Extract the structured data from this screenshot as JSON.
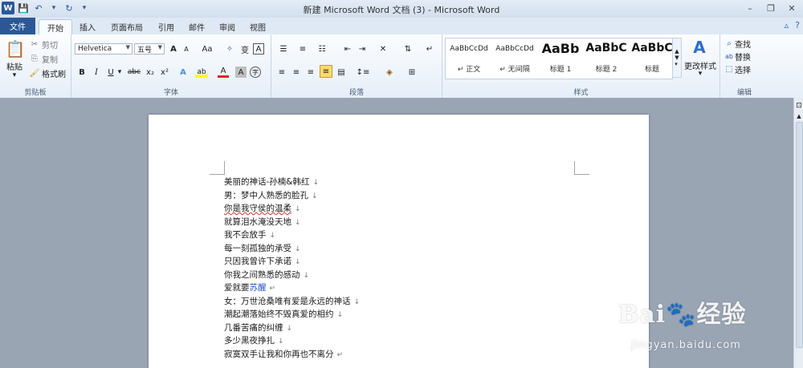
{
  "window": {
    "title": "新建 Microsoft Word 文档 (3)  -  Microsoft Word",
    "logo": "W"
  },
  "tabs": {
    "file": "文件",
    "items": [
      "开始",
      "插入",
      "页面布局",
      "引用",
      "邮件",
      "审阅",
      "视图"
    ]
  },
  "clipboard": {
    "paste": "粘贴",
    "cut": "剪切",
    "copy": "复制",
    "format_painter": "格式刷",
    "label": "剪贴板"
  },
  "font": {
    "name": "Helvetica",
    "size": "五号",
    "label": "字体",
    "buttons": {
      "grow": "A",
      "shrink": "A",
      "case": "Aa",
      "clear": "♥",
      "phonetic": "wén",
      "border": "A",
      "bold": "B",
      "italic": "I",
      "underline": "U",
      "strike": "abc",
      "sub": "x₂",
      "sup": "x²",
      "effects": "A",
      "highlight": "ab",
      "color": "A",
      "shade": "A",
      "circle": "字"
    }
  },
  "paragraph": {
    "label": "段落"
  },
  "styles": {
    "label": "样式",
    "items": [
      {
        "preview": "AaBbCcDd",
        "name": "↵ 正文"
      },
      {
        "preview": "AaBbCcDd",
        "name": "↵ 无间隔"
      },
      {
        "preview": "AaBb",
        "name": "标题 1"
      },
      {
        "preview": "AaBbC",
        "name": "标题 2"
      },
      {
        "preview": "AaBbC",
        "name": "标题"
      }
    ],
    "change": "更改样式"
  },
  "editing": {
    "label": "编辑",
    "find": "查找",
    "replace": "替换",
    "select": "选择"
  },
  "document": {
    "lines": [
      "美丽的神话-孙楠&韩红",
      "男：梦中人熟悉的脸孔",
      "你是我守侯的温柔",
      "就算泪水淹没天地",
      "我不会放手",
      "每一刻孤独的承受",
      "只因我曾许下承诺",
      "你我之间熟悉的感动",
      "爱就要",
      "女：万世沧桑唯有爱是永远的神话",
      "潮起潮落始终不毁真爱的相约",
      "几番苦痛的纠缠",
      "多少黑夜挣扎",
      "寂寞双手让我和你再也不离分"
    ],
    "highlight_word": "苏醒",
    "para_mark": "↓",
    "end_mark": "↵"
  },
  "watermark": {
    "brand": "Bai\u0001经验",
    "url": "jingyan.baidu.com"
  }
}
